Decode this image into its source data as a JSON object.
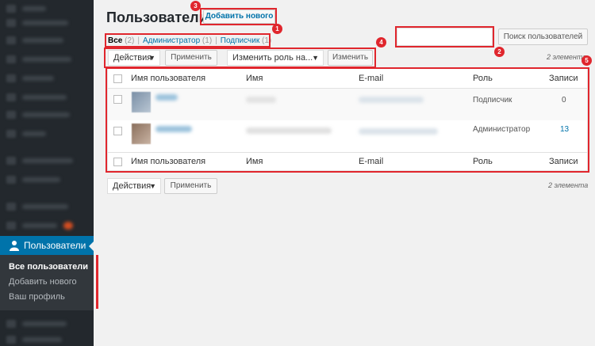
{
  "sidebar": {
    "users_label": "Пользователи",
    "submenu": [
      "Все пользователи",
      "Добавить нового",
      "Ваш профиль"
    ]
  },
  "header": {
    "title": "Пользователи",
    "add_new": "Добавить нового"
  },
  "filters": {
    "all": "Все",
    "all_count": "(2)",
    "admin": "Администратор",
    "admin_count": "(1)",
    "subscriber": "Подписчик",
    "subscriber_count": "(1)"
  },
  "search": {
    "value": "",
    "button": "Поиск пользователей"
  },
  "bulk_top": {
    "actions": "Действия",
    "apply": "Применить",
    "change_role": "Изменить роль на...",
    "change": "Изменить",
    "count": "2 элемента"
  },
  "bulk_bottom": {
    "actions": "Действия",
    "apply": "Применить",
    "count": "2 элемента"
  },
  "table": {
    "columns": [
      "Имя пользователя",
      "Имя",
      "E-mail",
      "Роль",
      "Записи"
    ],
    "rows": [
      {
        "role": "Подписчик",
        "posts": "0"
      },
      {
        "role": "Администратор",
        "posts": "13"
      }
    ]
  },
  "annotations": [
    "1",
    "2",
    "3",
    "4",
    "5"
  ],
  "colors": {
    "accent": "#0073aa",
    "sidebar_bg": "#23282d",
    "annotation": "#e0262d"
  }
}
